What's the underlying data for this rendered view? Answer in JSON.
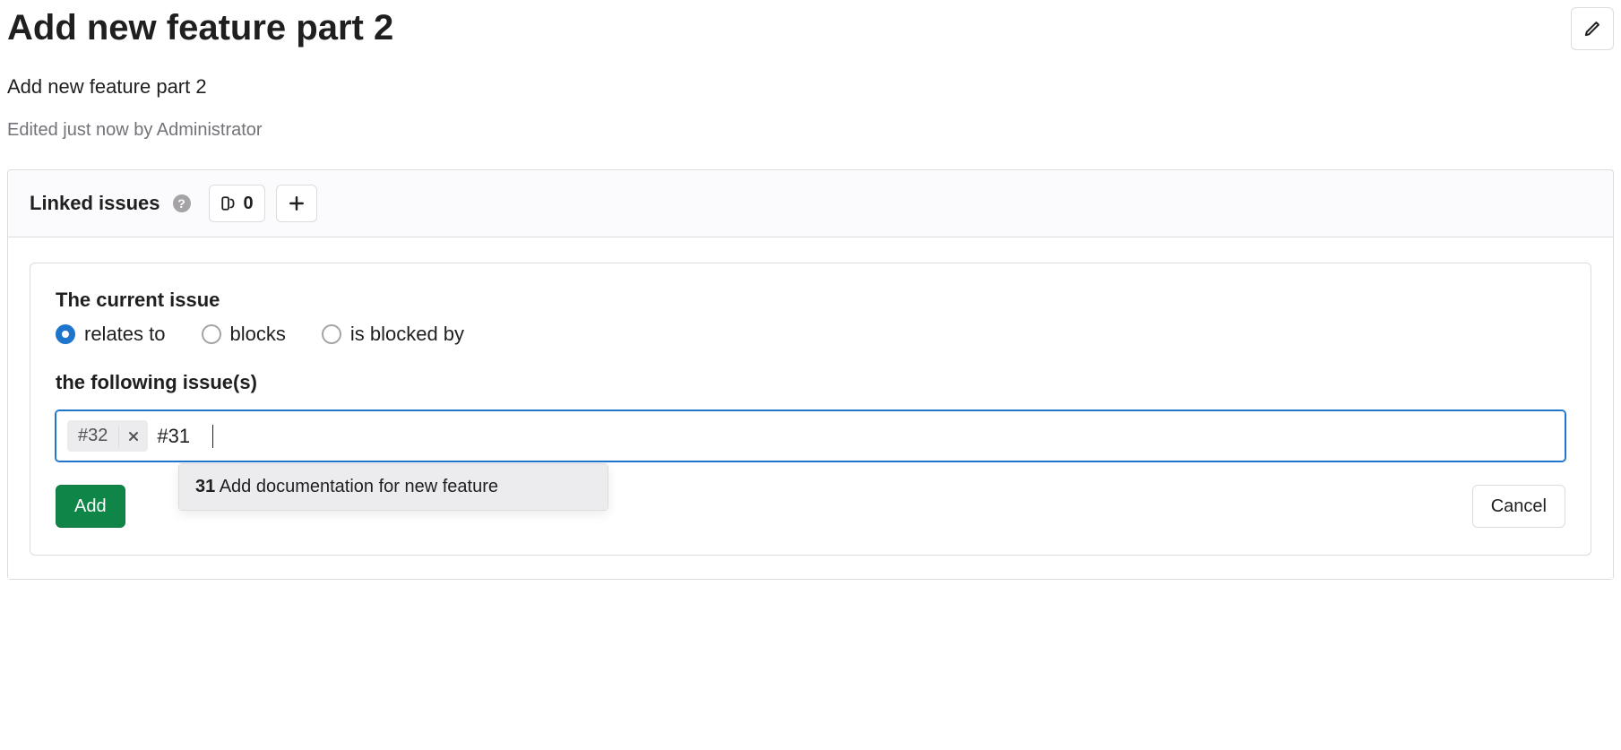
{
  "header": {
    "issue_title": "Add new feature part 2",
    "edit_icon_name": "pencil-icon"
  },
  "description": "Add new feature part 2",
  "meta": {
    "edited_text": "Edited just now by Administrator"
  },
  "linked_issues": {
    "section_title": "Linked issues",
    "count": "0",
    "help_icon_name": "help-icon",
    "issue_icon_name": "issue-icon",
    "plus_icon_name": "plus-icon"
  },
  "link_form": {
    "heading": "The current issue",
    "radios": [
      {
        "label": "relates to",
        "selected": true
      },
      {
        "label": "blocks",
        "selected": false
      },
      {
        "label": "is blocked by",
        "selected": false
      }
    ],
    "subheading": "the following issue(s)",
    "tokens": [
      {
        "text": "#32"
      }
    ],
    "input_value": "#31",
    "suggestions": [
      {
        "number": "31",
        "title": "Add documentation for new feature"
      }
    ],
    "add_button": "Add",
    "cancel_button": "Cancel"
  }
}
